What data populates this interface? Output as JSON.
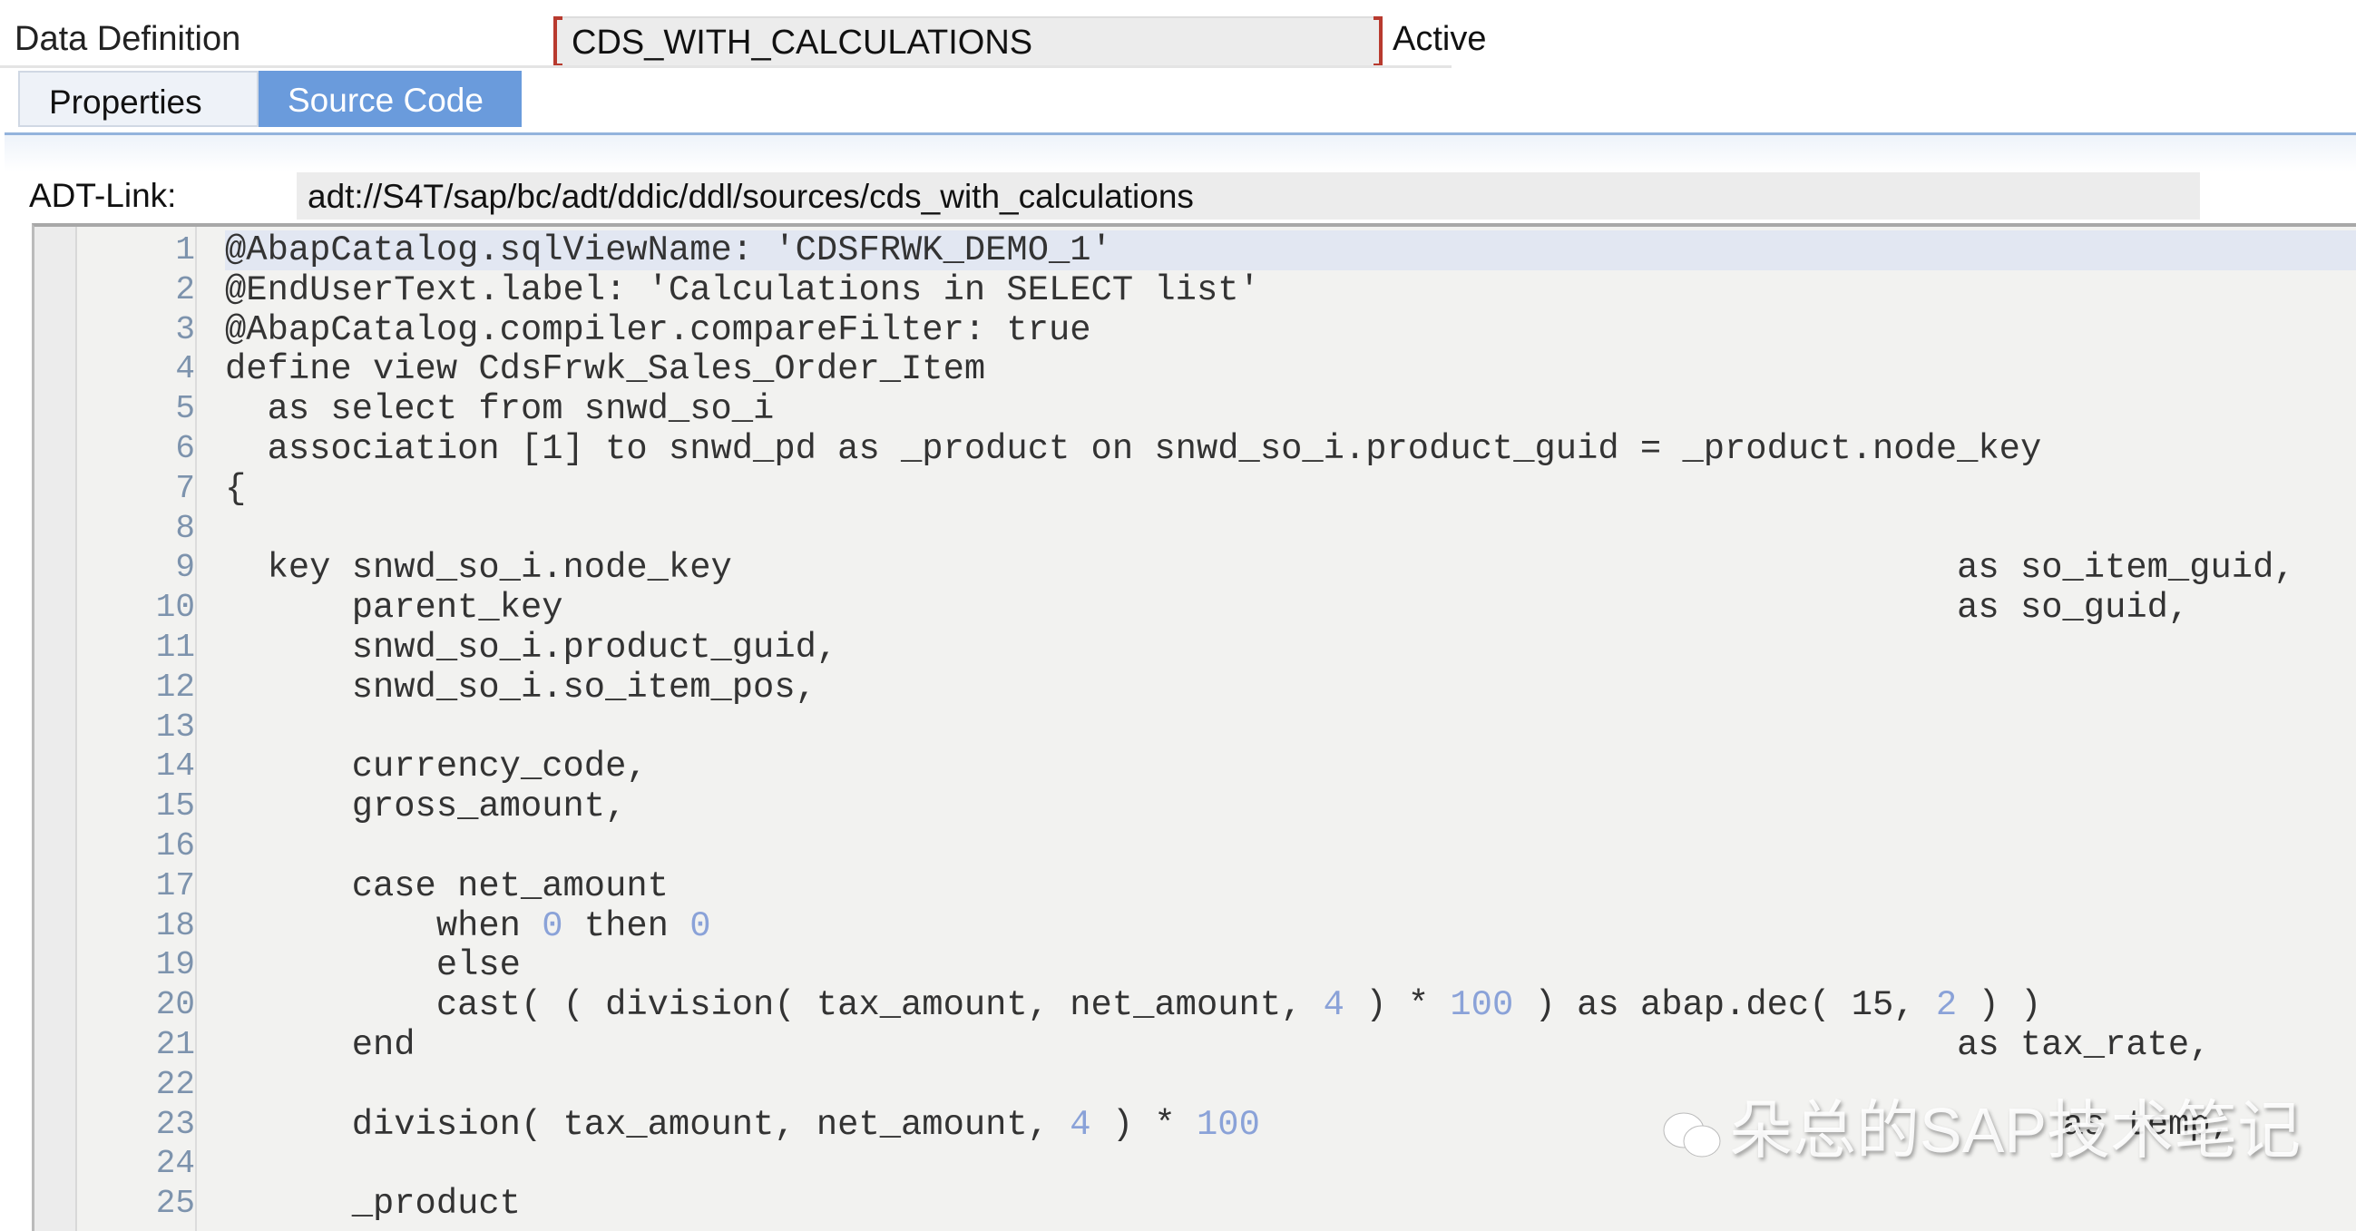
{
  "header": {
    "title": "Data Definition",
    "name": "CDS_WITH_CALCULATIONS",
    "status": "Active"
  },
  "tabs": [
    {
      "label": "Properties",
      "active": false
    },
    {
      "label": "Source Code",
      "active": true
    }
  ],
  "adt": {
    "label": "ADT-Link:",
    "value": "adt://S4T/sap/bc/adt/ddic/ddl/sources/cds_with_calculations"
  },
  "editor": {
    "current_line": 1,
    "lines": [
      [
        "@AbapCatalog.sqlViewName: 'CDSFRWK_DEMO_1'"
      ],
      [
        "@EndUserText.label: 'Calculations in SELECT list'"
      ],
      [
        "@AbapCatalog.compiler.compareFilter: true"
      ],
      [
        "define view CdsFrwk_Sales_Order_Item"
      ],
      [
        "  as select from snwd_so_i"
      ],
      [
        "  association [1] to snwd_pd as _product on snwd_so_i.product_guid = _product.node_key"
      ],
      [
        "{"
      ],
      [
        ""
      ],
      [
        "  key snwd_so_i.node_key                                                          as so_item_guid,"
      ],
      [
        "      parent_key                                                                  as so_guid,"
      ],
      [
        "      snwd_so_i.product_guid,"
      ],
      [
        "      snwd_so_i.so_item_pos,"
      ],
      [
        ""
      ],
      [
        "      currency_code,"
      ],
      [
        "      gross_amount,"
      ],
      [
        ""
      ],
      [
        "      case net_amount"
      ],
      [
        "          when ",
        "0",
        " then ",
        "0"
      ],
      [
        "          else"
      ],
      [
        "          cast( ( division( tax_amount, net_amount, ",
        "4",
        " ) * ",
        "100",
        " ) as abap.dec( 15, ",
        "2",
        " ) )"
      ],
      [
        "      end                                                                         as tax_rate,"
      ],
      [
        ""
      ],
      [
        "      division( tax_amount, net_amount, ",
        "4",
        " ) * ",
        "100",
        "                                      as temp,"
      ],
      [
        ""
      ],
      [
        "      _product"
      ]
    ]
  },
  "watermark": "朵总的SAP技术笔记",
  "colors": {
    "tab_active": "#6a9bdc",
    "number_literal": "#8aa2d8",
    "line_number": "#7d93ad",
    "current_line": "#e2e7f2"
  }
}
